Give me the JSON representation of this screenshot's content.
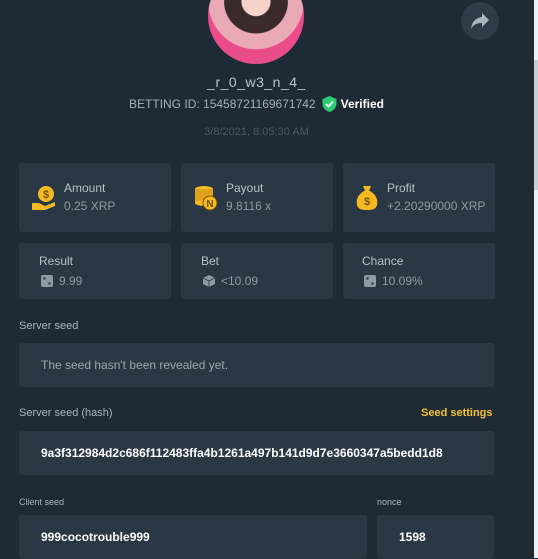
{
  "profile": {
    "username": "_r_0_w3_n_4_",
    "betting_id": "BETTING ID: 15458721169671742",
    "verified_label": "Verified",
    "date": "3/8/2021, 8:05:30 AM"
  },
  "stats": {
    "amount": {
      "label": "Amount",
      "value": "0.25 XRP"
    },
    "payout": {
      "label": "Payout",
      "value": "9.8116 x"
    },
    "profit": {
      "label": "Profit",
      "value": "+2.20290000 XRP"
    },
    "result": {
      "label": "Result",
      "value": "9.99"
    },
    "bet": {
      "label": "Bet",
      "value": "<10.09"
    },
    "chance": {
      "label": "Chance",
      "value": "10.09%"
    }
  },
  "server_seed": {
    "label": "Server seed",
    "value": "The seed hasn't been revealed yet."
  },
  "server_seed_hash": {
    "label": "Server seed (hash)",
    "settings_link": "Seed settings",
    "value": "9a3f312984d2c686f112483ffa4b1261a497b141d9d7e3660347a5bedd1d8"
  },
  "client_seed": {
    "label": "Client seed",
    "value": "999cocotrouble999"
  },
  "nonce": {
    "label": "nonce",
    "value": "1598"
  },
  "colors": {
    "background": "#1e2a35",
    "card": "#2a3744",
    "accent": "#f2c12e",
    "verified": "#2ecc71"
  },
  "icons": [
    "share-icon",
    "verified-check-icon",
    "coin-hand-icon",
    "coin-stack-icon",
    "money-bag-icon",
    "dice-icon"
  ]
}
